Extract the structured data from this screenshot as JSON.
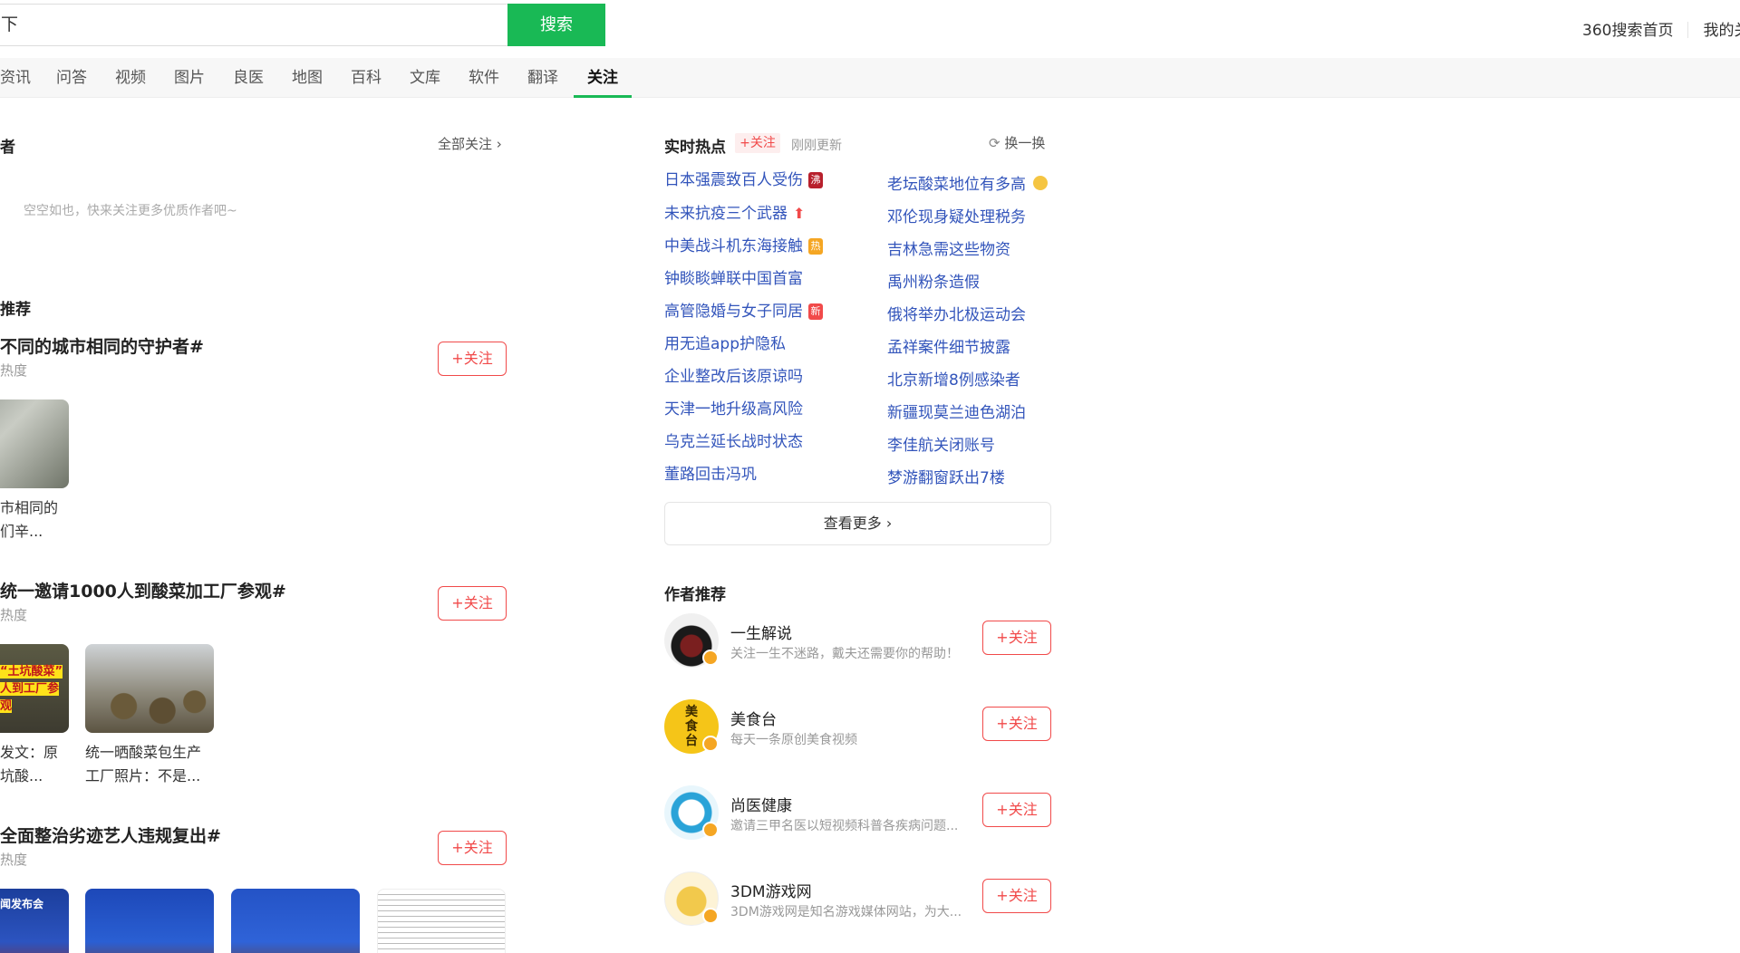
{
  "search": {
    "value": "下",
    "button": "搜索"
  },
  "top_links": [
    "360搜索首页",
    "我的关"
  ],
  "tabs": [
    {
      "label": "资讯"
    },
    {
      "label": "问答"
    },
    {
      "label": "视频"
    },
    {
      "label": "图片"
    },
    {
      "label": "良医"
    },
    {
      "label": "地图"
    },
    {
      "label": "百科"
    },
    {
      "label": "文库"
    },
    {
      "label": "软件"
    },
    {
      "label": "翻译"
    },
    {
      "label": "关注",
      "active": true
    }
  ],
  "left": {
    "section_title": "者",
    "all_follow": "全部关注",
    "empty_tip": "空空如也，快来关注更多优质作者吧~",
    "recommend_title": "推荐",
    "topics": [
      {
        "title": "不同的城市相同的守护者#",
        "heat": "热度",
        "follow": "+关注",
        "images": [
          {
            "caption": "市相同的\n们辛..."
          }
        ]
      },
      {
        "title": "统一邀请1000人到酸菜加工厂参观#",
        "heat": "热度",
        "follow": "+关注",
        "images": [
          {
            "caption": "发文：原\n坑酸...",
            "overlay": "“土坑酸菜”\n人到工厂参观"
          },
          {
            "caption": "统一晒酸菜包生产\n工厂照片：不是..."
          }
        ]
      },
      {
        "title": "全面整治劣迹艺人违规复出#",
        "heat": "热度",
        "follow": "+关注",
        "images": [
          {
            "overlay": "闻发布会"
          },
          {},
          {},
          {}
        ]
      }
    ]
  },
  "hot": {
    "title": "实时热点",
    "follow": "+关注",
    "update": "刚刚更新",
    "refresh": "换一换",
    "left_items": [
      {
        "text": "日本强震致百人受伤",
        "badge": "沸",
        "badge_color": "#b8202c"
      },
      {
        "text": "未来抗疫三个武器",
        "badge": "up",
        "badge_color": "#f14a4a"
      },
      {
        "text": "中美战斗机东海接触",
        "badge": "热",
        "badge_color": "#f5a623"
      },
      {
        "text": "钟睒睒蝉联中国首富"
      },
      {
        "text": "高管隐婚与女子同居",
        "badge": "新",
        "badge_color": "#f14a4a"
      },
      {
        "text": "用无追app护隐私"
      },
      {
        "text": "企业整改后该原谅吗"
      },
      {
        "text": "天津一地升级高风险"
      },
      {
        "text": "乌克兰延长战时状态"
      },
      {
        "text": "董路回击冯巩"
      }
    ],
    "right_items": [
      {
        "text": "老坛酸菜地位有多高",
        "badge": "emoji"
      },
      {
        "text": "邓伦现身疑处理税务"
      },
      {
        "text": "吉林急需这些物资"
      },
      {
        "text": "禹州粉条造假"
      },
      {
        "text": "俄将举办北极运动会"
      },
      {
        "text": "孟祥案件细节披露"
      },
      {
        "text": "北京新增8例感染者"
      },
      {
        "text": "新疆现莫兰迪色湖泊"
      },
      {
        "text": "李佳航关闭账号"
      },
      {
        "text": "梦游翻窗跃出7楼"
      }
    ],
    "more": "查看更多"
  },
  "authors": {
    "title": "作者推荐",
    "list": [
      {
        "name": "一生解说",
        "desc": "关注一生不迷路，戴夫还需要你的帮助！",
        "follow": "+关注"
      },
      {
        "name": "美食台",
        "desc": "每天一条原创美食视频",
        "follow": "+关注",
        "avatar_text": "美食台"
      },
      {
        "name": "尚医健康",
        "desc": "邀请三甲名医以短视频科普各疾病问题...",
        "follow": "+关注"
      },
      {
        "name": "3DM游戏网",
        "desc": "3DM游戏网是知名游戏媒体网站，为大...",
        "follow": "+关注"
      }
    ]
  },
  "colors": {
    "accent": "#19b955",
    "follow": "#f14a4a",
    "hot_link": "#3355bb"
  }
}
